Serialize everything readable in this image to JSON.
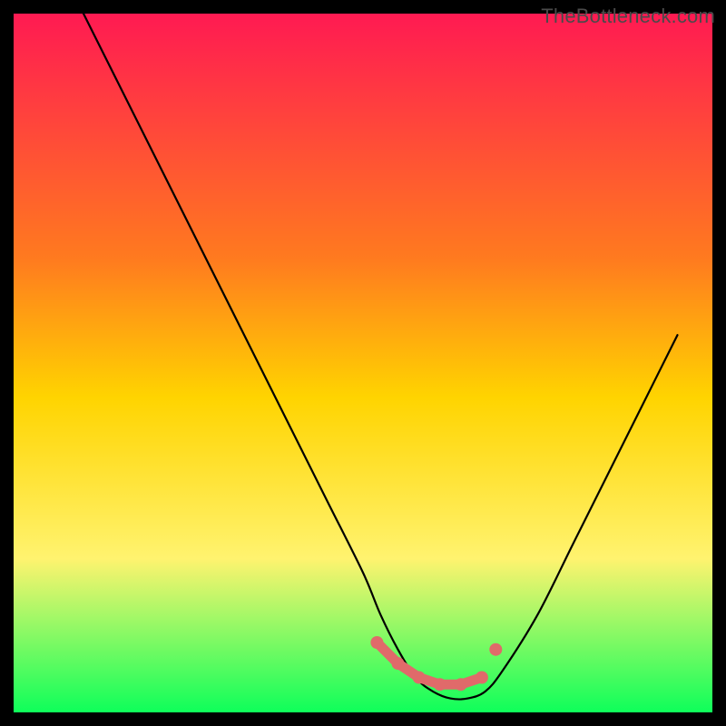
{
  "watermark": "TheBottleneck.com",
  "colors": {
    "gradient_top": "#ff1a52",
    "gradient_mid1": "#ff7a1f",
    "gradient_mid2": "#ffd400",
    "gradient_mid3": "#fff36f",
    "gradient_bottom": "#0eff5a",
    "background": "#000000",
    "curve": "#000000",
    "marker": "#e06a6a"
  },
  "chart_data": {
    "type": "line",
    "title": "",
    "xlabel": "",
    "ylabel": "",
    "xlim": [
      0,
      100
    ],
    "ylim": [
      0,
      100
    ],
    "grid": false,
    "series": [
      {
        "name": "bottleneck-curve",
        "x": [
          10,
          15,
          20,
          25,
          30,
          35,
          40,
          45,
          50,
          52.5,
          55,
          57.5,
          60,
          62.5,
          65,
          67.5,
          70,
          75,
          80,
          85,
          90,
          95
        ],
        "values": [
          100,
          90,
          80,
          70,
          60,
          50,
          40,
          30,
          20,
          14,
          9,
          5,
          3,
          2,
          2,
          3,
          6,
          14,
          24,
          34,
          44,
          54
        ]
      }
    ],
    "markers": {
      "name": "highlight-band",
      "x": [
        52,
        55,
        58,
        61,
        64,
        67,
        69
      ],
      "values": [
        10,
        7,
        5,
        4,
        4,
        5,
        9
      ]
    }
  }
}
